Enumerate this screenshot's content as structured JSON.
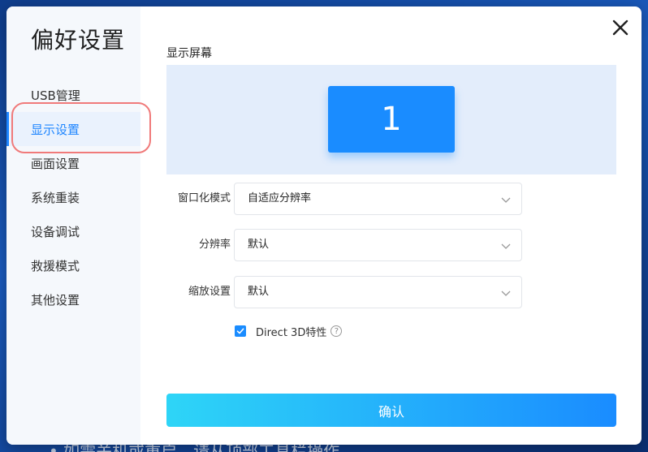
{
  "backdrop": {
    "text": "• 如需关机或重启，请从顶部工具栏操作"
  },
  "sidebar": {
    "title": "偏好设置",
    "items": [
      {
        "label": "USB管理"
      },
      {
        "label": "显示设置",
        "active": true
      },
      {
        "label": "画面设置"
      },
      {
        "label": "系统重装"
      },
      {
        "label": "设备调试"
      },
      {
        "label": "救援模式"
      },
      {
        "label": "其他设置"
      }
    ]
  },
  "main": {
    "section_title": "显示屏幕",
    "screen_number": "1",
    "fields": [
      {
        "label": "窗口化模式",
        "value": "自适应分辨率"
      },
      {
        "label": "分辨率",
        "value": "默认"
      },
      {
        "label": "缩放设置",
        "value": "默认"
      }
    ],
    "direct3d": {
      "label": "Direct 3D特性",
      "checked": true,
      "help": "?"
    },
    "confirm_label": "确认"
  },
  "icons": {
    "close": "close-icon",
    "chevron": "chevron-down-icon",
    "check": "check-icon",
    "help": "help-circle-icon"
  },
  "colors": {
    "accent": "#1a8cff",
    "accent_gradient_start": "#2ed5f7",
    "active_nav_bg": "#eaf2fd",
    "annotation_ring": "#f07a7a",
    "screen_panel_bg": "#e3edfb"
  }
}
